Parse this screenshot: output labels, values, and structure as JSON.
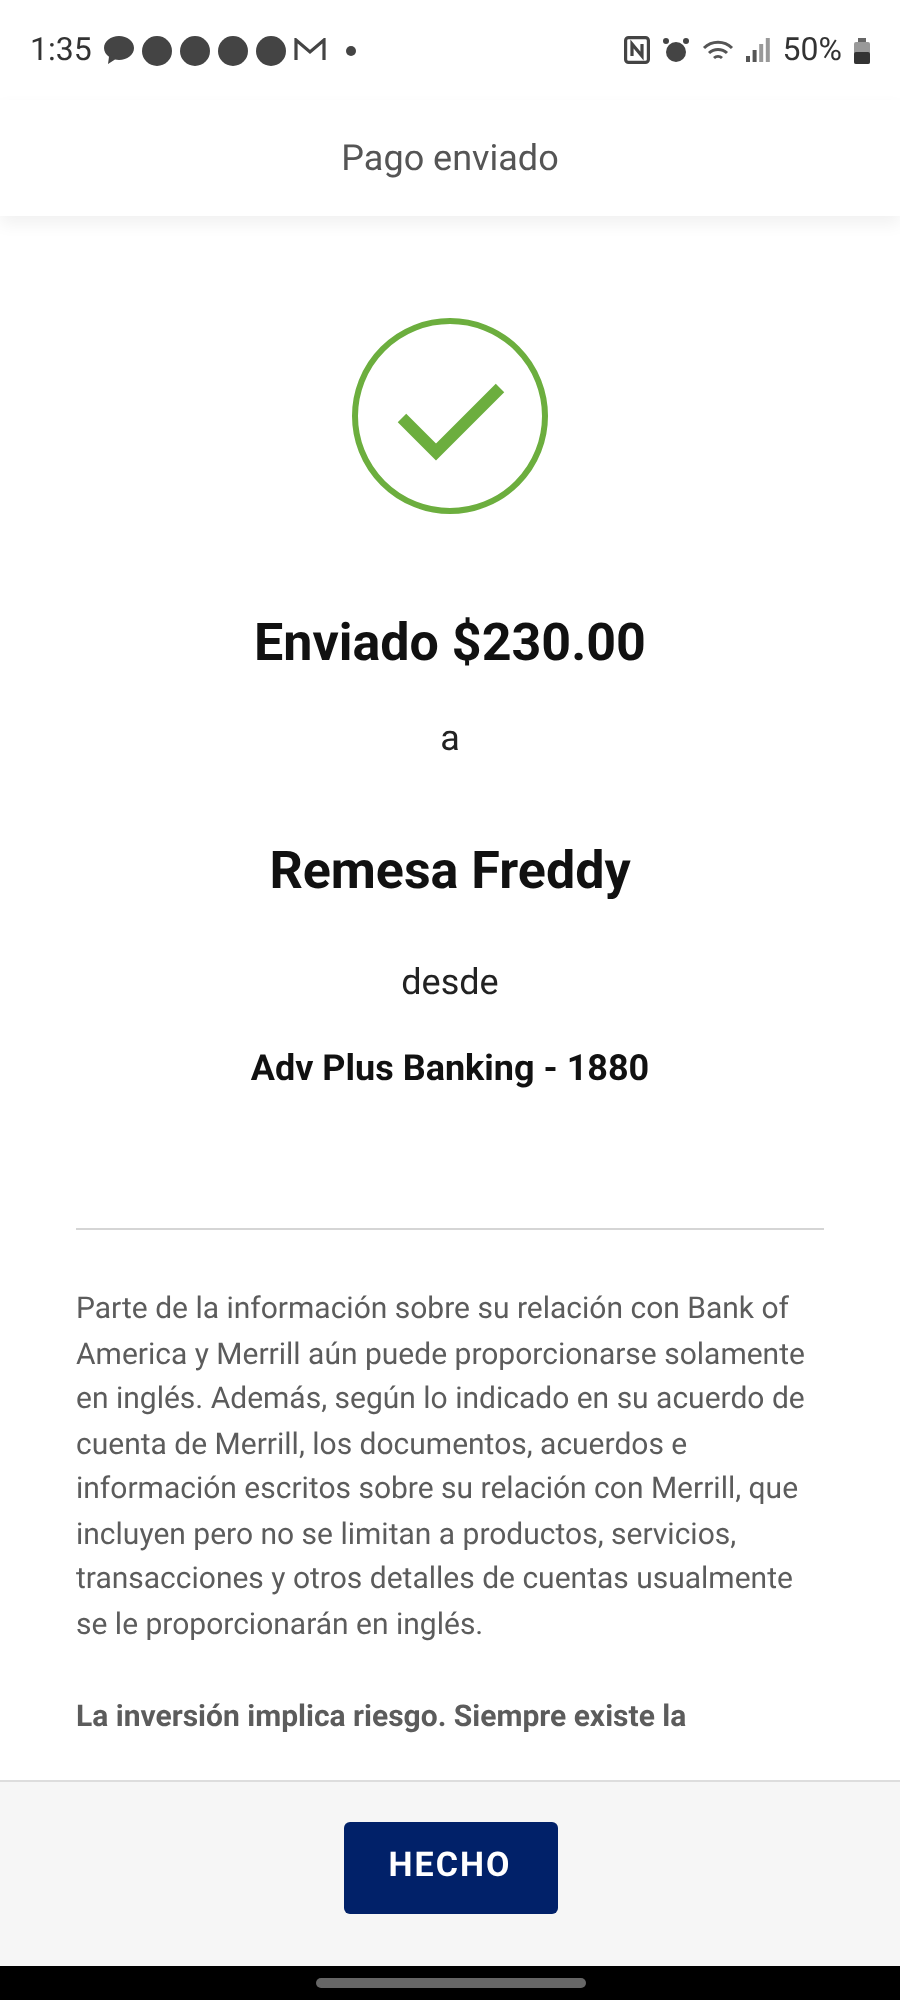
{
  "status_bar": {
    "time": "1:35",
    "battery": "50%"
  },
  "header": {
    "title": "Pago enviado"
  },
  "confirmation": {
    "amount_line": "Enviado $230.00",
    "to_word": "a",
    "recipient": "Remesa Freddy",
    "from_word": "desde",
    "account": "Adv Plus Banking - 1880"
  },
  "disclosures": [
    {
      "text": "Parte de la información sobre su relación con Bank of America y Merrill aún puede proporcionarse solamente en inglés. Además, según lo indicado en su acuerdo de cuenta de Merrill, los documentos, acuerdos e información escritos sobre su relación con Merrill, que incluyen pero no se limitan a productos, servicios, transacciones y otros detalles de cuentas usualmente se le proporcionarán en inglés.",
      "bold": false
    },
    {
      "text": "La inversión implica riesgo. Siempre existe la",
      "bold": true
    }
  ],
  "footer": {
    "button": "HECHO"
  }
}
